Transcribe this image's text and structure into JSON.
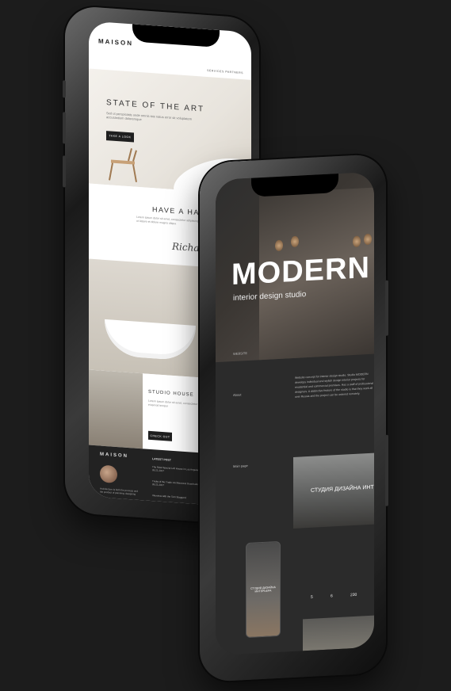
{
  "left_phone": {
    "logo": "MAISON",
    "nav": "SERVICES   PARTNERS",
    "hero_title": "STATE OF THE ART",
    "hero_text": "Sed ut perspiciatis unde omnis iste natus error sit voluptatem accusantium doloremque",
    "hero_button": "TAKE A LOOK",
    "section_title": "HAVE A HANDSOME",
    "section_text": "Lorem ipsum dolor sit amet, consectetur adipiscing elit, sed do eiusmod tempor incididunt ut labore et dolore magna aliqua",
    "signature": "Richard M",
    "studio_title": "STUDIO HOUSE",
    "studio_text": "Lorem ipsum dolor sit amet, consectetur adipiscing elit, sed do eiusmod tempor",
    "studio_button": "CHECK OUT",
    "footer_logo": "MAISON",
    "footer_text": "Architecture is both the process and the product of planning, designing",
    "footer_latest": "LATEST POST",
    "footer_posts": [
      {
        "title": "The Most Special Loft House in Los Angeles",
        "date": "09.21.2017"
      },
      {
        "title": "Tricks of the Trade: Architectural Guardrails",
        "date": "09.21.2017"
      },
      {
        "title": "Interview with the Tom Staggard",
        "date": ""
      }
    ]
  },
  "right_phone": {
    "website_label": "WEBSITE",
    "title": "MODERN",
    "subtitle": "interior design studio",
    "about_label": "About",
    "about_text": "Website concept for interior design studio. Studio MODERN develops individual and stylish design interior projects for residential and commercial premises. Has a staff of professional designers. A distinctive feature of the studio is that they work all over Russia and the project can be ordered remotely.",
    "main_page_label": "Main page",
    "banner_text": "СТУДИЯ ДИЗАЙНА ИНТЕРЬ",
    "mini_text": "СТУДИЯ ДИЗАЙНА ИНТЕРЬЕРА",
    "stats": [
      "5",
      "6",
      "230"
    ]
  },
  "colors": {
    "background": "#1c1c1c",
    "light_screen": "#ffffff",
    "dark_screen": "#2b2b2b"
  }
}
